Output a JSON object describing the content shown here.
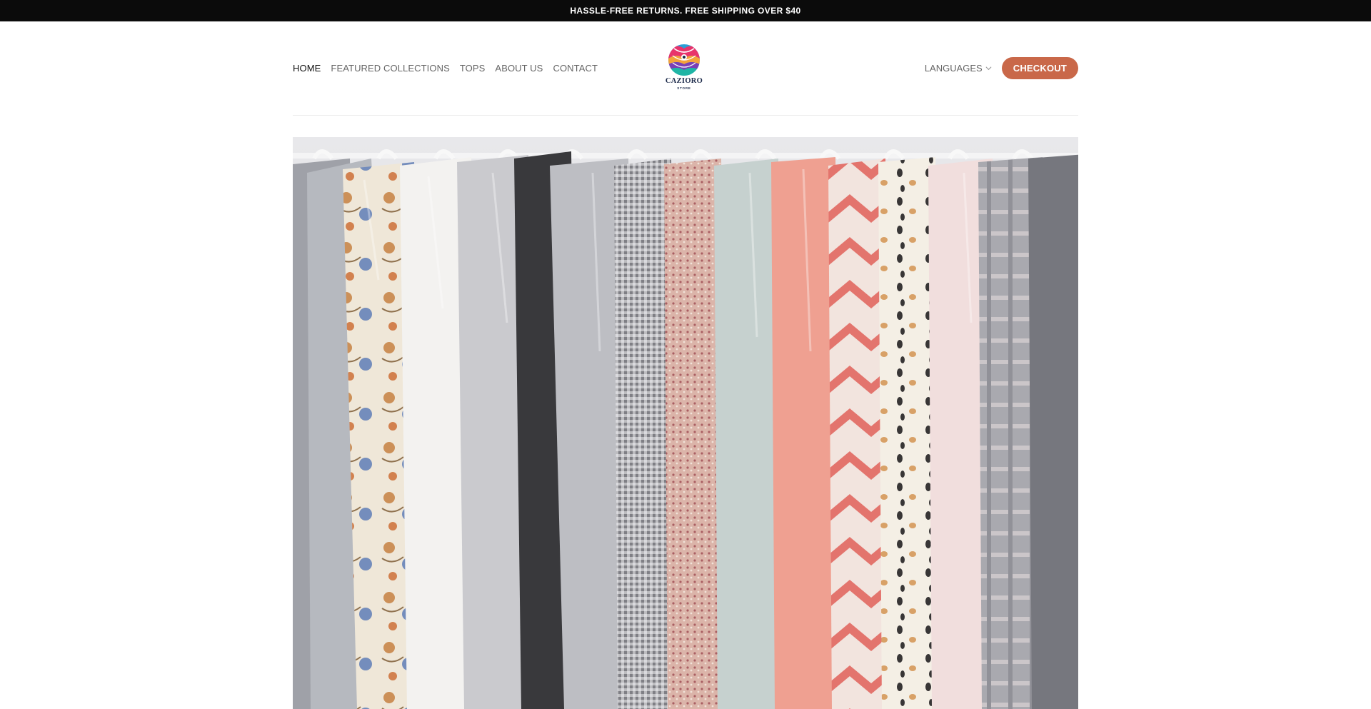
{
  "announcement": "HASSLE-FREE RETURNS. FREE SHIPPING OVER $40",
  "nav": {
    "items": [
      {
        "label": "HOME",
        "active": true
      },
      {
        "label": "FEATURED COLLECTIONS",
        "active": false
      },
      {
        "label": "TOPS",
        "active": false
      },
      {
        "label": "ABOUT US",
        "active": false
      },
      {
        "label": "CONTACT",
        "active": false
      }
    ]
  },
  "logo": {
    "name": "CAZIORO",
    "subtitle": "STORE"
  },
  "header_right": {
    "languages_label": "LANGUAGES",
    "languages_icon": "chevron-down-icon",
    "checkout_label": "CHECKOUT"
  },
  "colors": {
    "accent": "#c96849",
    "topbar": "#0b0b0b"
  },
  "hero": {
    "image": "clothes-rack-shirts-photo"
  }
}
